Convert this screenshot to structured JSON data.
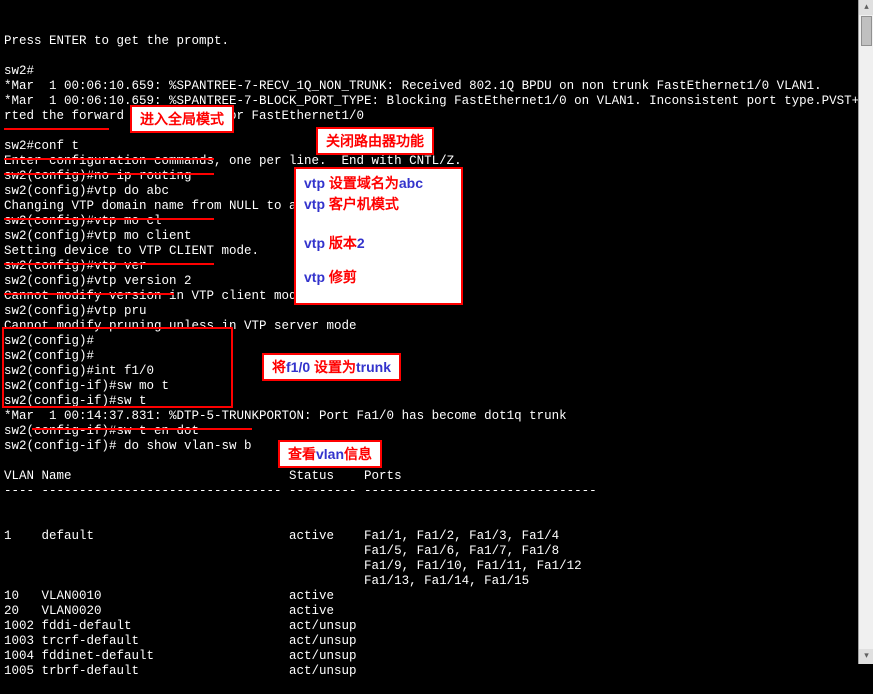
{
  "terminal": {
    "lines": [
      "Press ENTER to get the prompt.",
      "",
      "sw2#",
      "*Mar  1 00:06:10.659: %SPANTREE-7-RECV_1Q_NON_TRUNK: Received 802.1Q BPDU on non trunk FastEthernet1/0 VLAN1.",
      "*Mar  1 00:06:10.659: %SPANTREE-7-BLOCK_PORT_TYPE: Blocking FastEthernet1/0 on VLAN1. Inconsistent port type.PVST+: resta",
      "rted the forward delay timer for FastEthernet1/0",
      "",
      "sw2#conf t",
      "Enter configuration commands, one per line.  End with CNTL/Z.",
      "sw2(config)#no ip routing",
      "sw2(config)#vtp do abc",
      "Changing VTP domain name from NULL to abc",
      "sw2(config)#vtp mo cl",
      "sw2(config)#vtp mo client",
      "Setting device to VTP CLIENT mode.",
      "sw2(config)#vtp ver",
      "sw2(config)#vtp version 2",
      "Cannot modify version in VTP client mode",
      "sw2(config)#vtp pru",
      "Cannot modify pruning unless in VTP server mode",
      "sw2(config)#",
      "sw2(config)#",
      "sw2(config)#int f1/0",
      "sw2(config-if)#sw mo t",
      "sw2(config-if)#sw t",
      "*Mar  1 00:14:37.831: %DTP-5-TRUNKPORTON: Port Fa1/0 has become dot1q trunk",
      "sw2(config-if)#sw t en dot",
      "sw2(config-if)# do show vlan-sw b",
      "",
      "VLAN Name                             Status    Ports",
      "---- -------------------------------- --------- -------------------------------"
    ]
  },
  "vlan_table": {
    "rows": [
      {
        "vlan": "1",
        "name": "default",
        "status": "active",
        "ports": [
          "Fa1/1, Fa1/2, Fa1/3, Fa1/4",
          "Fa1/5, Fa1/6, Fa1/7, Fa1/8",
          "Fa1/9, Fa1/10, Fa1/11, Fa1/12",
          "Fa1/13, Fa1/14, Fa1/15"
        ]
      },
      {
        "vlan": "10",
        "name": "VLAN0010",
        "status": "active",
        "ports": []
      },
      {
        "vlan": "20",
        "name": "VLAN0020",
        "status": "active",
        "ports": []
      },
      {
        "vlan": "1002",
        "name": "fddi-default",
        "status": "act/unsup",
        "ports": []
      },
      {
        "vlan": "1003",
        "name": "trcrf-default",
        "status": "act/unsup",
        "ports": []
      },
      {
        "vlan": "1004",
        "name": "fddinet-default",
        "status": "act/unsup",
        "ports": []
      },
      {
        "vlan": "1005",
        "name": "trbrf-default",
        "status": "act/unsup",
        "ports": []
      }
    ]
  },
  "callouts": {
    "c1": "进入全局模式",
    "c2": "关闭路由器功能",
    "c3_l1": "vtp 设置域名为abc",
    "c3_l2": "vtp 客户机模式",
    "c3_l3": "vtp 版本2",
    "c3_l4": "vtp 修剪",
    "c4": "将f1/0 设置为trunk",
    "c5": "查看vlan信息"
  },
  "scroll": {
    "up": "▴",
    "down": "▾"
  }
}
